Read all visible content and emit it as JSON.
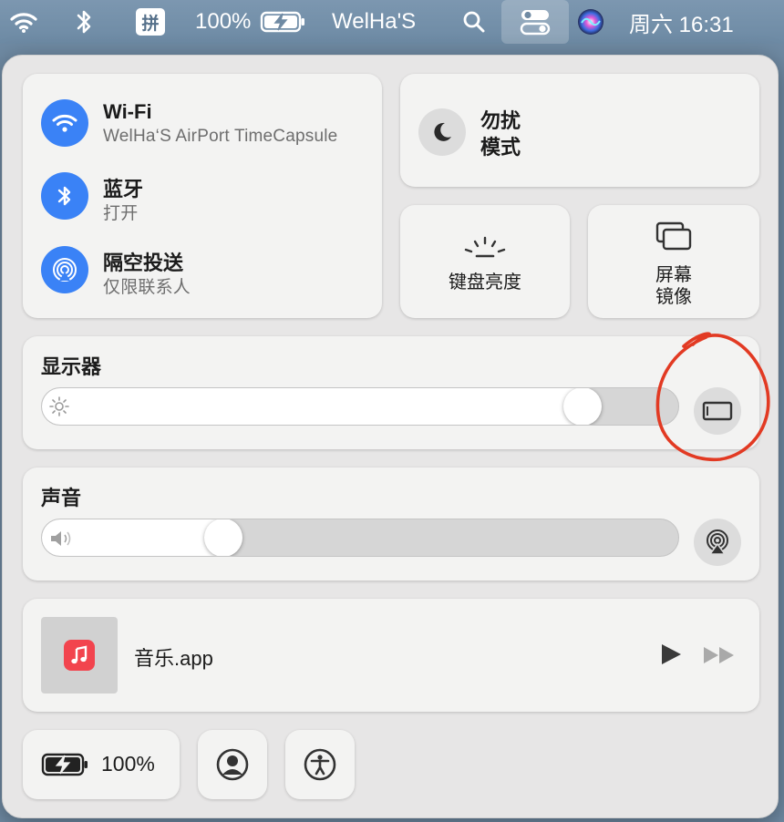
{
  "menubar": {
    "ime_label": "拼",
    "battery_percent": "100%",
    "username": "WelHa'S",
    "datetime": "周六 16:31",
    "icons": [
      "wifi-icon",
      "bluetooth-icon",
      "battery-charging-icon",
      "search-icon",
      "control-center-icon",
      "siri-icon"
    ]
  },
  "network": {
    "wifi": {
      "title": "Wi-Fi",
      "subtitle": "WelHa‘S AirPort TimeCapsule"
    },
    "bluetooth": {
      "title": "蓝牙",
      "subtitle": "打开"
    },
    "airdrop": {
      "title": "隔空投送",
      "subtitle": "仅限联系人"
    }
  },
  "focus": {
    "line1": "勿扰",
    "line2": "模式"
  },
  "keyboard_brightness": {
    "label": "键盘亮度"
  },
  "screen_mirroring": {
    "line1": "屏幕",
    "line2": "镜像"
  },
  "display": {
    "label": "显示器",
    "brightness": 0.87
  },
  "sound": {
    "label": "声音",
    "volume": 0.27
  },
  "now_playing": {
    "app": "音乐.app"
  },
  "bottom": {
    "battery_percent": "100%"
  },
  "colors": {
    "accent": "#3a82f6",
    "annotation": "#e23a23",
    "music_red": "#f2444e"
  }
}
